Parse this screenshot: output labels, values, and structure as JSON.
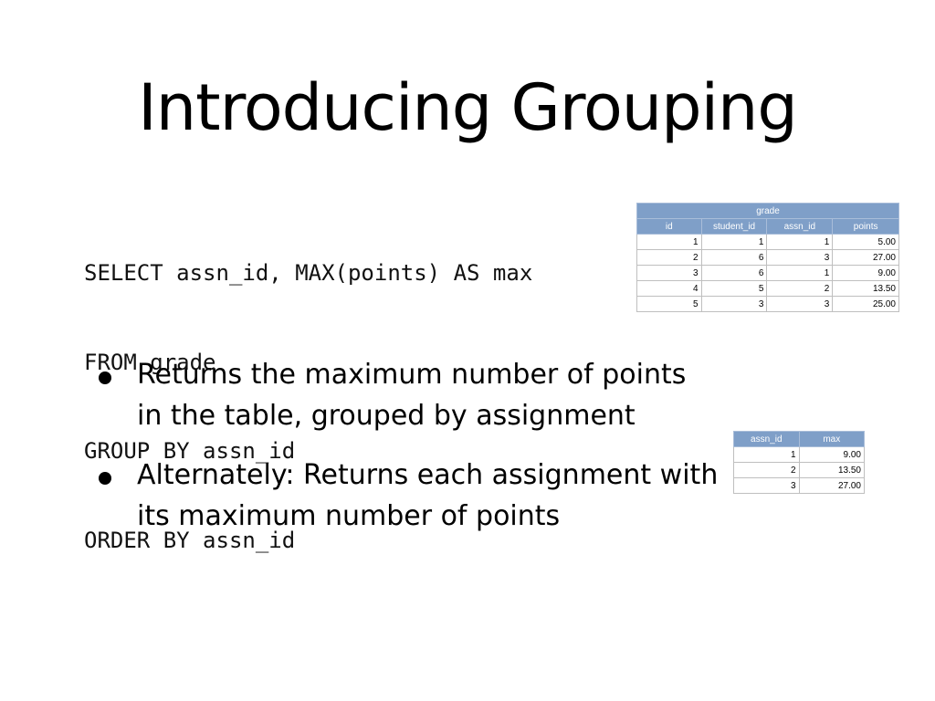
{
  "slide": {
    "title": "Introducing Grouping",
    "code_lines": [
      "SELECT assn_id, MAX(points) AS max",
      "FROM grade",
      "GROUP BY assn_id",
      "ORDER BY assn_id"
    ],
    "bullets": [
      "Returns the maximum number of points in the table, grouped by assignment",
      "Alternately: Returns each assignment with its maximum number of points"
    ]
  },
  "grade_table": {
    "caption": "grade",
    "columns": [
      "id",
      "student_id",
      "assn_id",
      "points"
    ],
    "rows": [
      [
        "1",
        "1",
        "1",
        "5.00"
      ],
      [
        "2",
        "6",
        "3",
        "27.00"
      ],
      [
        "3",
        "6",
        "1",
        "9.00"
      ],
      [
        "4",
        "5",
        "2",
        "13.50"
      ],
      [
        "5",
        "3",
        "3",
        "25.00"
      ]
    ]
  },
  "result_table": {
    "columns": [
      "assn_id",
      "max"
    ],
    "rows": [
      [
        "1",
        "9.00"
      ],
      [
        "2",
        "13.50"
      ],
      [
        "3",
        "27.00"
      ]
    ]
  },
  "colors": {
    "header_fill": "#7f9fc8",
    "header_text": "#ffffff",
    "text": "#000000",
    "background": "#ffffff"
  }
}
